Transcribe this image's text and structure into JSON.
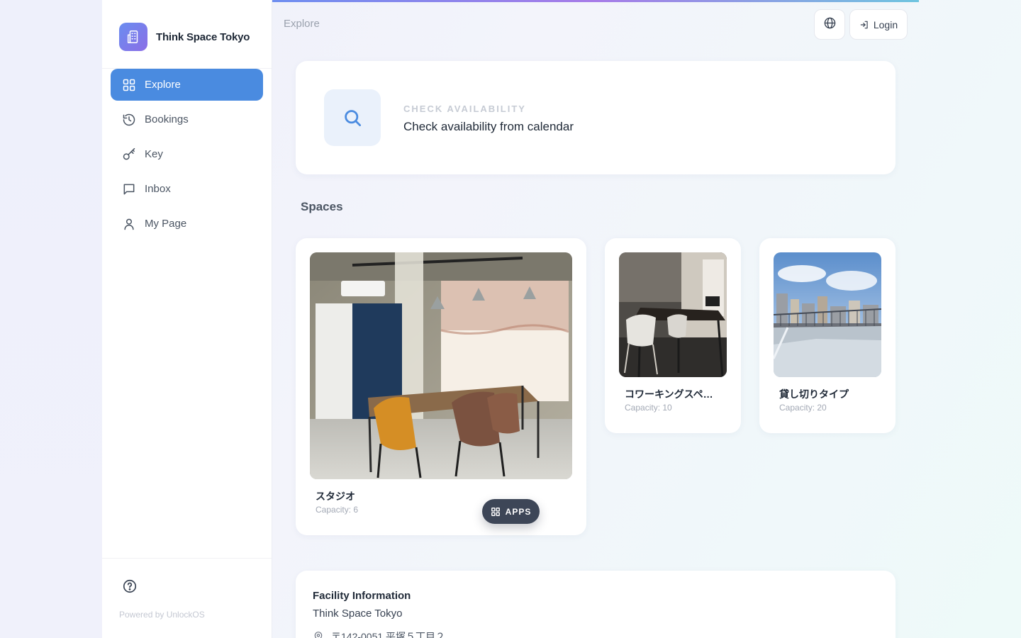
{
  "brand": {
    "name": "Think Space Tokyo"
  },
  "sidebar": {
    "items": [
      {
        "label": "Explore",
        "icon": "grid-icon",
        "active": true
      },
      {
        "label": "Bookings",
        "icon": "history-icon"
      },
      {
        "label": "Key",
        "icon": "key-icon"
      },
      {
        "label": "Inbox",
        "icon": "message-icon"
      },
      {
        "label": "My Page",
        "icon": "user-icon"
      }
    ],
    "powered_by": "Powered by UnlockOS"
  },
  "header": {
    "breadcrumb": "Explore",
    "login_label": "Login"
  },
  "availability": {
    "kicker": "CHECK AVAILABILITY",
    "title": "Check availability from calendar"
  },
  "spaces": {
    "title": "Spaces",
    "items": [
      {
        "name": "スタジオ",
        "capacity": "Capacity: 6"
      },
      {
        "name": "コワーキングスペ…",
        "capacity": "Capacity: 10"
      },
      {
        "name": "貸し切りタイプ",
        "capacity": "Capacity: 20"
      }
    ]
  },
  "apps_button": {
    "label": "APPS"
  },
  "facility": {
    "title": "Facility Information",
    "name": "Think Space Tokyo",
    "address": "〒142-0051 平塚５丁目２"
  },
  "colors": {
    "accent": "#4a8be0",
    "brand_gradient_start": "#6a8df0",
    "brand_gradient_end": "#8b6ee6"
  }
}
